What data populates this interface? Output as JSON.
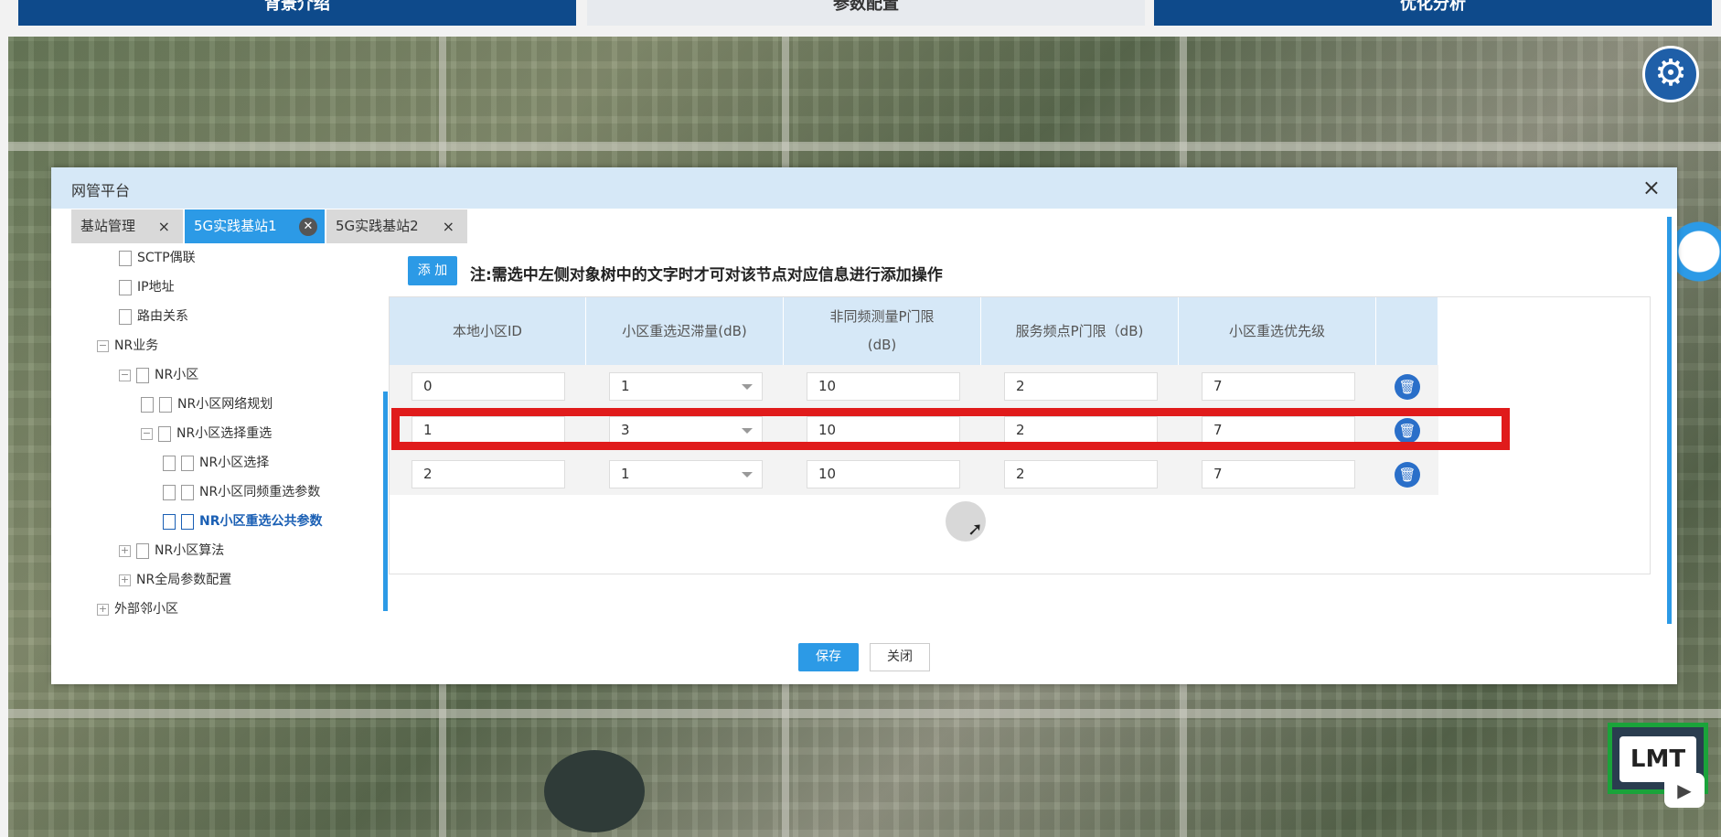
{
  "top_tabs": [
    {
      "label": "背景介绍"
    },
    {
      "label": "参数配置"
    },
    {
      "label": "优化分析"
    }
  ],
  "modal": {
    "title": "网管平台",
    "tabs": [
      {
        "label": "基站管理"
      },
      {
        "label": "5G实践基站1"
      },
      {
        "label": "5G实践基站2"
      }
    ],
    "close_symbol": "×"
  },
  "tree": [
    {
      "label": "SCTP偶联"
    },
    {
      "label": "IP地址"
    },
    {
      "label": "路由关系"
    },
    {
      "label": "NR业务",
      "toggle": "−"
    },
    {
      "label": "NR小区",
      "toggle": "−"
    },
    {
      "label": "NR小区网络规划"
    },
    {
      "label": "NR小区选择重选",
      "toggle": "−"
    },
    {
      "label": "NR小区选择"
    },
    {
      "label": "NR小区同频重选参数"
    },
    {
      "label": "NR小区重选公共参数"
    },
    {
      "label": "NR小区算法",
      "toggle": "+"
    },
    {
      "label": "NR全局参数配置",
      "toggle": "+"
    },
    {
      "label": "外部邻小区",
      "toggle": "+"
    }
  ],
  "panel": {
    "add_label": "添 加",
    "note": "注:需选中左侧对象树中的文字时才可对该节点对应信息进行添加操作"
  },
  "table": {
    "headers": [
      "本地小区ID",
      "小区重选迟滞量(dB)",
      "非同频测量P门限",
      "(dB)",
      "服务频点P门限（dB)",
      "小区重选优先级"
    ],
    "rows": [
      [
        "0",
        "1",
        "10",
        "2",
        "7"
      ],
      [
        "1",
        "3",
        "10",
        "2",
        "7"
      ],
      [
        "2",
        "1",
        "10",
        "2",
        "7"
      ]
    ]
  },
  "footer": {
    "save_label": "保存",
    "close_label": "关闭"
  },
  "badge": {
    "lmt_text": "LMT"
  },
  "icons": {
    "gear": "gear-icon",
    "delete": "trash-icon",
    "close": "close-icon"
  },
  "colors": {
    "accent": "#2c9ae6",
    "header_bg": "#d6e8f7",
    "highlight": "#e01b1b",
    "nav_bg": "#0e4a8b"
  }
}
